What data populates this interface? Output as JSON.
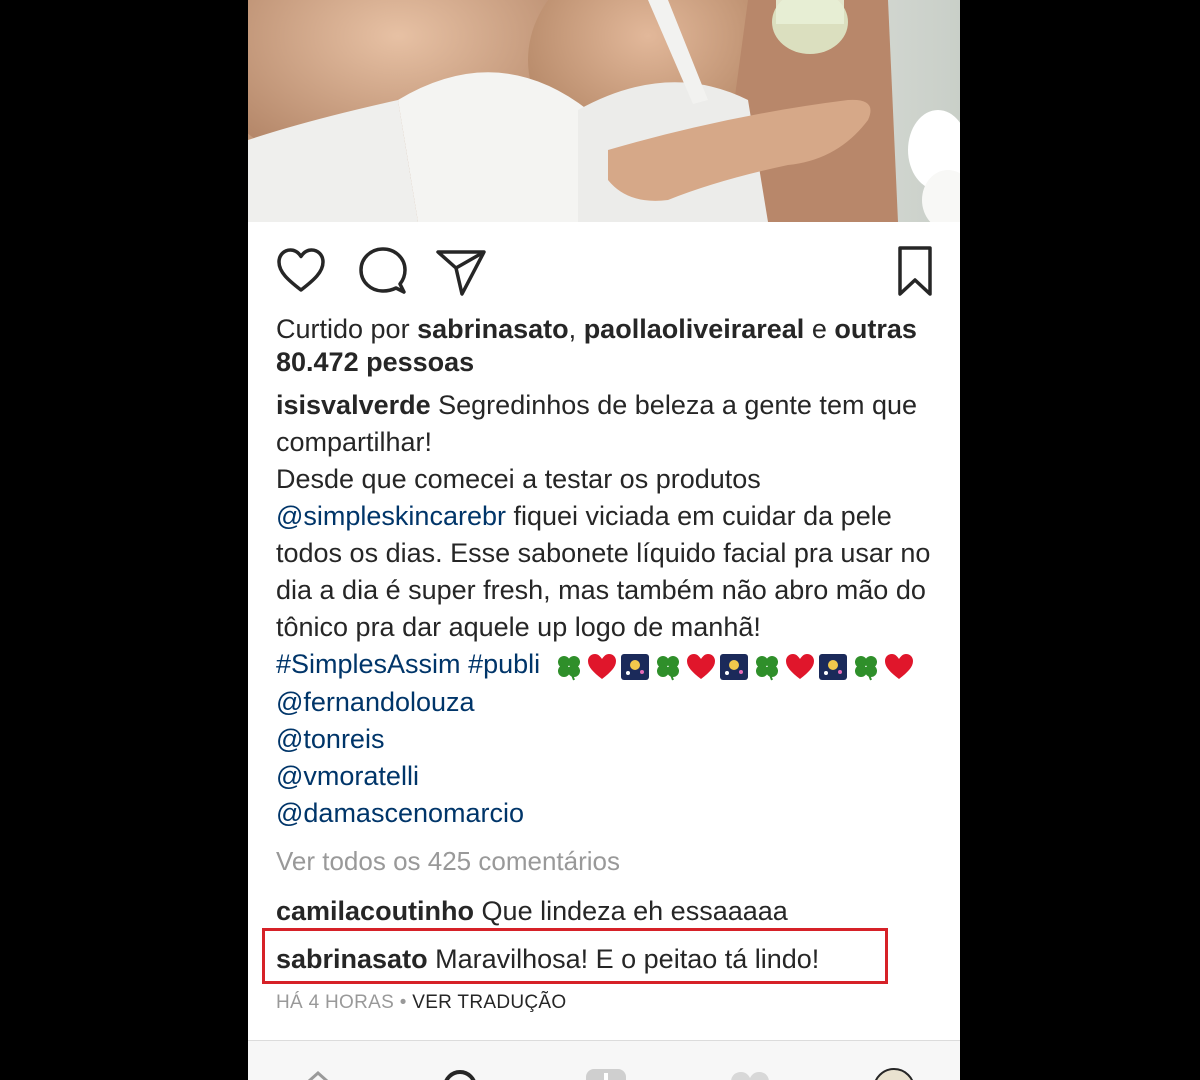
{
  "post": {
    "photo_alt": "",
    "likes": {
      "prefix": "Curtido por",
      "user1": "sabrinasato",
      "separator": ",",
      "user2": "paollaoliveirareal",
      "conjunction": "e",
      "others_label": "outras",
      "count_label": "80.472 pessoas"
    },
    "caption": {
      "username": "isisvalverde",
      "line1": "Segredinhos de beleza a gente tem que compartilhar!",
      "line2": "Desde que comecei a testar os produtos",
      "mention1": "@simpleskincarebr",
      "line3": "fiquei viciada em cuidar da pele todos os dias. Esse sabonete líquido facial pra usar no dia a dia é super fresh, mas também não abro mão do tônico pra dar aquele up logo de manhã!",
      "hashtag1": "#SimplesAssim",
      "hashtag2": "#publi",
      "emoji_sequence": [
        "clover",
        "heart",
        "fireworks",
        "clover",
        "heart",
        "fireworks",
        "clover",
        "heart",
        "fireworks",
        "clover",
        "heart"
      ],
      "mentions": [
        "@fernandolouza",
        "@tonreis",
        "@vmoratelli",
        "@damascenomarcio"
      ]
    },
    "view_all_comments": "Ver todos os 425 comentários",
    "comments": [
      {
        "username": "camilacoutinho",
        "text": "Que lindeza eh essaaaaa"
      },
      {
        "username": "sabrinasato",
        "text": "Maravilhosa! E o peitao tá lindo!"
      }
    ],
    "timestamp": "HÁ 4 HORAS",
    "timestamp_sep": "•",
    "translate_label": "VER TRADUÇÃO"
  },
  "icons": {
    "like": "heart-outline-icon",
    "comment": "comment-bubble-icon",
    "share": "paper-plane-icon",
    "save": "bookmark-icon"
  },
  "colors": {
    "text": "#262626",
    "link": "#003569",
    "muted": "#999999",
    "highlight": "#d62128"
  }
}
